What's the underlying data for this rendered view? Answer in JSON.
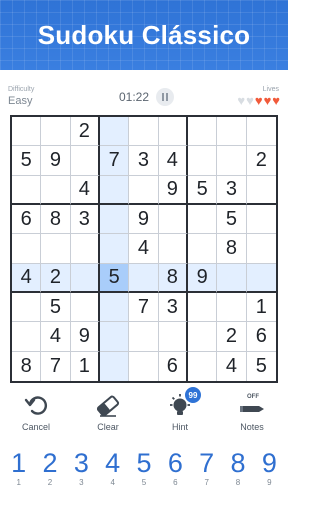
{
  "banner": {
    "title": "Sudoku Clássico"
  },
  "status": {
    "difficulty_label": "Difficulty",
    "difficulty_value": "Easy",
    "timer": "01:22",
    "lives_label": "Lives",
    "lives_total": 5,
    "lives_remaining": 3
  },
  "board": {
    "selected_row": 5,
    "selected_col": 3,
    "cells": [
      [
        "",
        "",
        "2",
        "",
        "",
        "",
        "",
        "",
        ""
      ],
      [
        "5",
        "9",
        "",
        "7",
        "3",
        "4",
        "",
        "",
        "2"
      ],
      [
        "",
        "",
        "4",
        "",
        "",
        "9",
        "5",
        "3",
        ""
      ],
      [
        "6",
        "8",
        "3",
        "",
        "9",
        "",
        "",
        "5",
        ""
      ],
      [
        "",
        "",
        "",
        "",
        "4",
        "",
        "",
        "8",
        ""
      ],
      [
        "4",
        "2",
        "",
        "5",
        "",
        "8",
        "9",
        "",
        ""
      ],
      [
        "",
        "5",
        "",
        "",
        "7",
        "3",
        "",
        "",
        "1"
      ],
      [
        "",
        "4",
        "9",
        "",
        "",
        "",
        "",
        "2",
        "6"
      ],
      [
        "8",
        "7",
        "1",
        "",
        "",
        "6",
        "",
        "4",
        "5"
      ]
    ]
  },
  "tools": {
    "undo_label": "Cancel",
    "erase_label": "Clear",
    "hint_label": "Hint",
    "hint_count": "99",
    "notes_label": "Notes",
    "notes_state": "OFF"
  },
  "numpad": [
    {
      "digit": "1",
      "count": "1"
    },
    {
      "digit": "2",
      "count": "2"
    },
    {
      "digit": "3",
      "count": "3"
    },
    {
      "digit": "4",
      "count": "4"
    },
    {
      "digit": "5",
      "count": "5"
    },
    {
      "digit": "6",
      "count": "6"
    },
    {
      "digit": "7",
      "count": "7"
    },
    {
      "digit": "8",
      "count": "8"
    },
    {
      "digit": "9",
      "count": "9"
    }
  ]
}
